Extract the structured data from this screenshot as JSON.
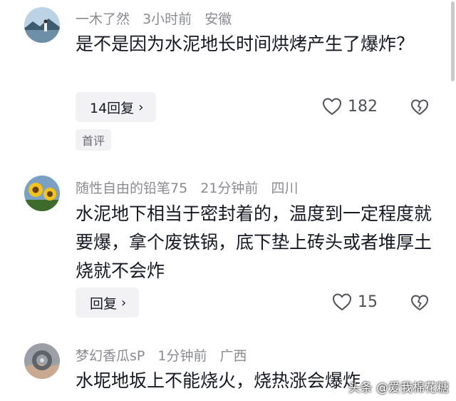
{
  "comments": [
    {
      "username": "一木了然",
      "time": "3小时前",
      "location": "安徽",
      "text": "是不是因为水泥地长时间烘烤产生了爆炸？",
      "reply_label": "14回复",
      "likes": "182",
      "tag": "首评",
      "avatar_icon": "lake-landscape-avatar"
    },
    {
      "username": "随性自由的铅笔75",
      "time": "21分钟前",
      "location": "四川",
      "text": "水泥地下相当于密封着的，温度到一定程度就要爆，拿个废铁锅，底下垫上砖头或者堆厚土烧就不会炸",
      "reply_label": "回复",
      "likes": "15",
      "avatar_icon": "sunflower-avatar"
    },
    {
      "username": "梦幻香瓜sP",
      "time": "1分钟前",
      "location": "广西",
      "text": "水坭地坂上不能烧火，烧热涨会爆炸",
      "avatar_icon": "ring-in-hand-avatar"
    }
  ],
  "icons": {
    "like": "heart-outline-icon",
    "dislike": "broken-heart-icon",
    "reply_chevron": "chevron-right-icon"
  },
  "watermark": "头条 @爱我棉花糖",
  "colors": {
    "meta_text": "#8a8b91",
    "body_text": "#161823",
    "button_bg": "#f2f2f4"
  }
}
